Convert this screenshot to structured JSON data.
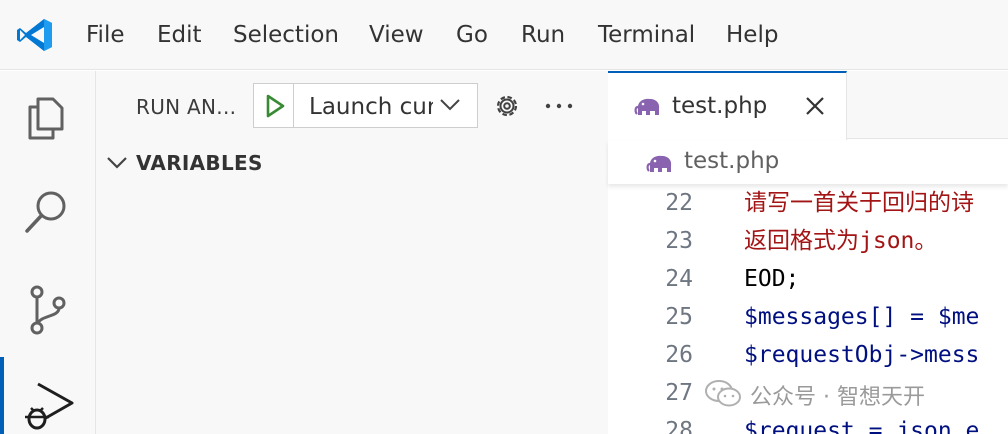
{
  "menu": {
    "items": [
      "File",
      "Edit",
      "Selection",
      "View",
      "Go",
      "Run",
      "Terminal",
      "Help"
    ]
  },
  "activity_bar": {
    "icons": [
      "files-icon",
      "search-icon",
      "source-control-icon",
      "run-debug-icon"
    ],
    "active": "run-debug-icon"
  },
  "sidebar": {
    "title": "RUN AN...",
    "launch_config": "Launch currentfile",
    "sections": {
      "variables": "VARIABLES"
    }
  },
  "editor": {
    "tab": {
      "label": "test.php",
      "icon": "php-elephant-icon"
    },
    "breadcrumb": {
      "label": "test.php"
    },
    "lines": [
      {
        "num": "22",
        "text": "请写一首关于回归的诗"
      },
      {
        "num": "23",
        "text": "返回格式为json。"
      },
      {
        "num": "24",
        "text": "EOD;"
      },
      {
        "num": "25",
        "text": "$messages[] = $me"
      },
      {
        "num": "26",
        "text": "$requestObj->mess"
      },
      {
        "num": "27",
        "text": ""
      },
      {
        "num": "28",
        "text": "$request = json_e"
      }
    ]
  },
  "watermark": {
    "text": "公众号 · 智想天开"
  },
  "colors": {
    "accent": "#005fb8",
    "string": "#a31515",
    "variable": "#001080",
    "php_icon": "#8a63b0",
    "debug_play": "#388a34"
  }
}
